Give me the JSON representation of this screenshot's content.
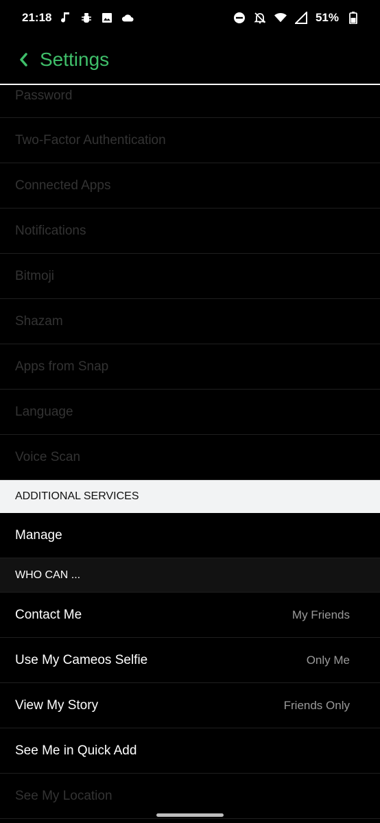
{
  "status_bar": {
    "time": "21:18",
    "battery": "51%",
    "left_icons": [
      "music-note-icon",
      "bug-icon",
      "image-icon",
      "cloud-icon"
    ],
    "right_icons": [
      "do-not-disturb-icon",
      "bell-off-icon",
      "wifi-icon",
      "signal-icon",
      "battery-icon"
    ]
  },
  "header": {
    "title": "Settings",
    "accent": "#3fbf6a"
  },
  "account_items": [
    {
      "label": "Password"
    },
    {
      "label": "Two-Factor Authentication"
    },
    {
      "label": "Connected Apps"
    },
    {
      "label": "Notifications"
    },
    {
      "label": "Bitmoji"
    },
    {
      "label": "Shazam"
    },
    {
      "label": "Apps from Snap"
    },
    {
      "label": "Language"
    },
    {
      "label": "Voice Scan"
    }
  ],
  "additional_services": {
    "header": "ADDITIONAL SERVICES",
    "items": [
      {
        "label": "Manage"
      }
    ]
  },
  "who_can": {
    "header": "WHO CAN ...",
    "items": [
      {
        "label": "Contact Me",
        "value": "My Friends"
      },
      {
        "label": "Use My Cameos Selfie",
        "value": "Only Me"
      },
      {
        "label": "View My Story",
        "value": "Friends Only"
      },
      {
        "label": "See Me in Quick Add",
        "value": ""
      },
      {
        "label": "See My Location",
        "value": ""
      }
    ]
  }
}
